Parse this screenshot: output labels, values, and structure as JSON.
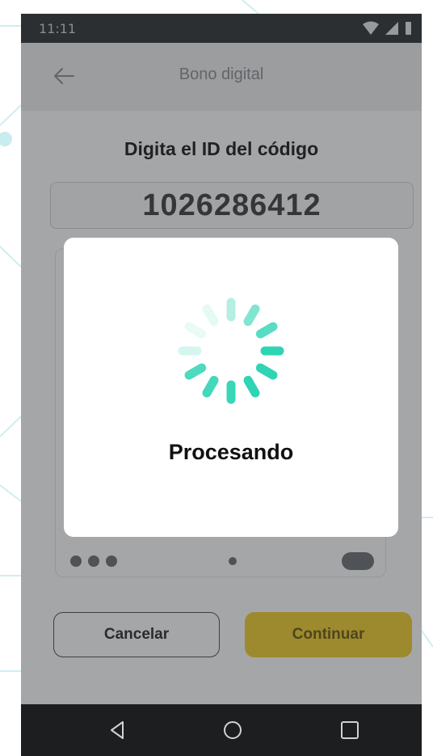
{
  "status_bar": {
    "time": "11:11"
  },
  "app_bar": {
    "title": "Bono digital"
  },
  "instruction": "Digita el ID del código",
  "code_value": "1026286412",
  "buttons": {
    "cancel": "Cancelar",
    "continue": "Continuar"
  },
  "modal": {
    "message": "Procesando"
  },
  "icons": {
    "back": "back-arrow-icon",
    "spinner": "loading-spinner-icon",
    "nav_back": "triangle-back-icon",
    "nav_home": "circle-home-icon",
    "nav_recents": "square-recents-icon"
  },
  "colors": {
    "accent": "#f2cf2f",
    "spinner": "#2fd4b4",
    "status_bar": "#2f3335",
    "nav_bar": "#1c1e1f"
  }
}
